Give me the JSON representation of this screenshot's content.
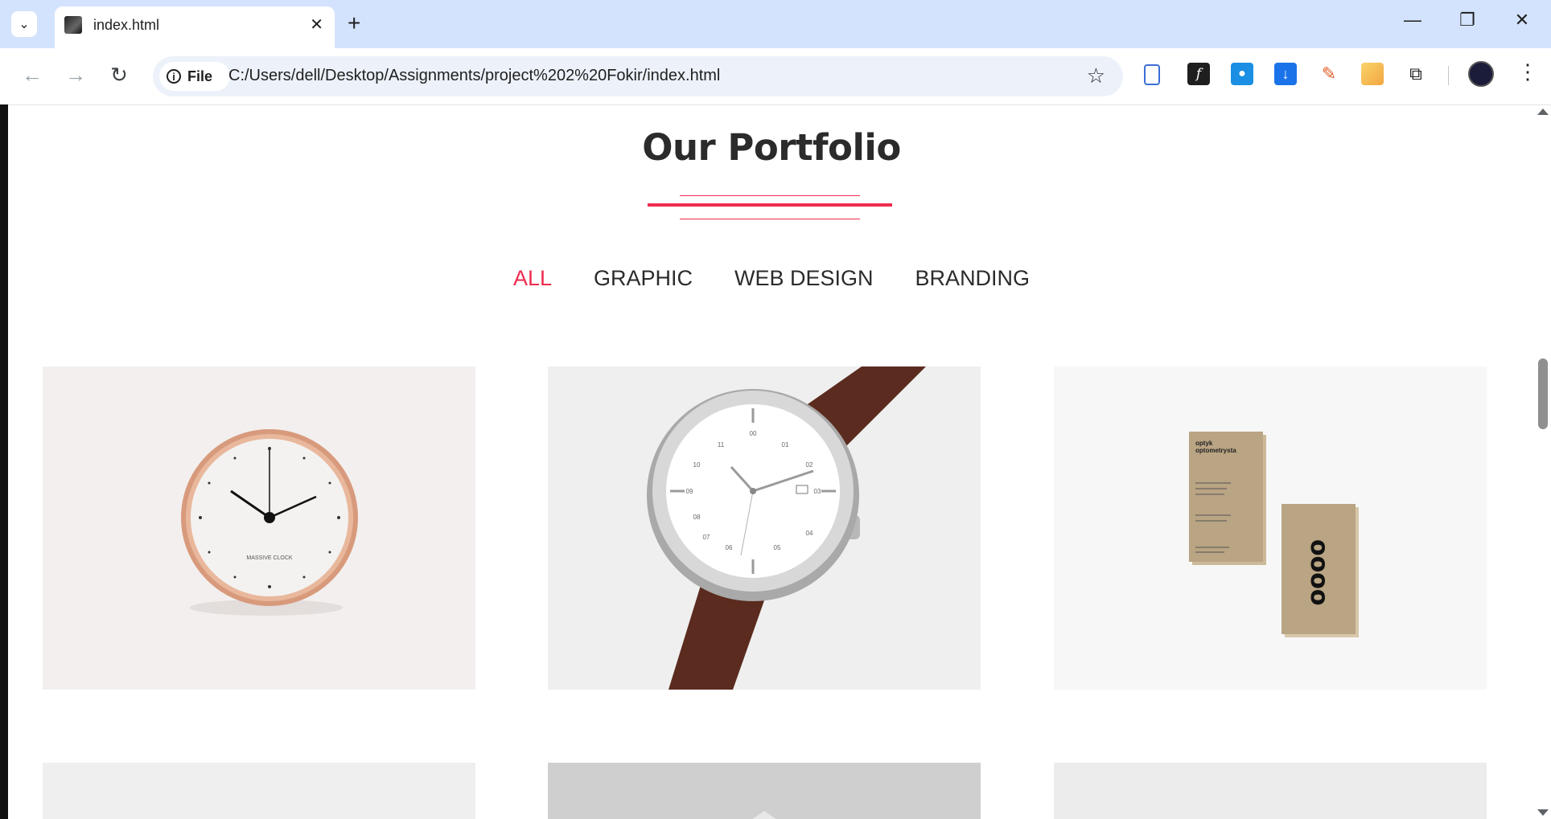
{
  "browser": {
    "tab_title": "index.html",
    "new_tab_symbol": "+",
    "site_chip": "File",
    "url": "C:/Users/dell/Desktop/Assignments/project%202%20Fokir/index.html"
  },
  "page": {
    "title": "Our Portfolio",
    "filters": [
      "ALL",
      "GRAPHIC",
      "WEB DESIGN",
      "BRANDING"
    ],
    "active_filter": "ALL",
    "accent_color": "#ee2c4f"
  },
  "portfolio_items": [
    {
      "image": "wall-clock-image",
      "clock_brand": "MASSIVE CLOCK"
    },
    {
      "image": "wristwatch-image",
      "watch_numbers": [
        "11",
        "00",
        "01",
        "10",
        "02",
        "09",
        "03",
        "08",
        "04",
        "07",
        "06",
        "05"
      ]
    },
    {
      "image": "business-cards-image",
      "card_heading": "optyk\noptometrysta",
      "card_logo": "oooo"
    },
    {
      "image": "portfolio-item-4"
    },
    {
      "image": "portfolio-item-5"
    },
    {
      "image": "portfolio-item-6"
    }
  ]
}
